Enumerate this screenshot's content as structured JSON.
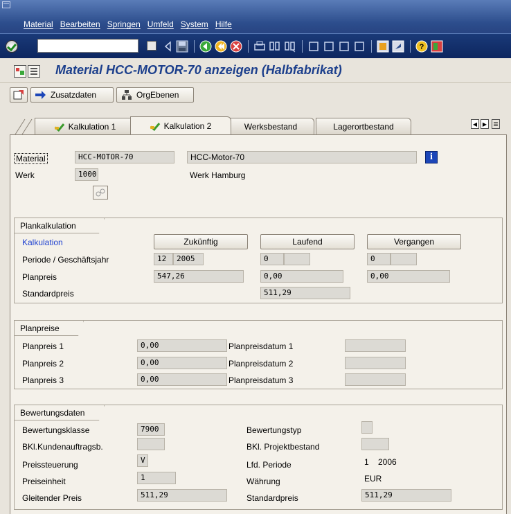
{
  "menubar": {
    "items": [
      "Material",
      "Bearbeiten",
      "Springen",
      "Umfeld",
      "System",
      "Hilfe"
    ]
  },
  "toolbar": {
    "command_value": "",
    "icons": [
      "enter-icon",
      "save-icon",
      "back-icon",
      "exit-icon",
      "cancel-icon",
      "print-icon",
      "find-icon",
      "find-next-icon",
      "first-page-icon",
      "prev-page-icon",
      "next-page-icon",
      "last-page-icon",
      "new-session-icon",
      "shortcut-icon",
      "help-icon",
      "layout-icon"
    ]
  },
  "title": {
    "text": "Material HCC-MOTOR-70 anzeigen (Halbfabrikat)"
  },
  "app_toolbar": {
    "zusatzdaten": "Zusatzdaten",
    "orgebenen": "OrgEbenen"
  },
  "tabs": [
    {
      "label": "Kalkulation 1",
      "checked": true,
      "active": false
    },
    {
      "label": "Kalkulation 2",
      "checked": true,
      "active": true
    },
    {
      "label": "Werksbestand",
      "checked": false,
      "active": false
    },
    {
      "label": "Lagerortbestand",
      "checked": false,
      "active": false
    }
  ],
  "header": {
    "material_label": "Material",
    "material_value": "HCC-MOTOR-70",
    "material_desc": "HCC-Motor-70",
    "werk_label": "Werk",
    "werk_value": "1000",
    "werk_desc": "Werk Hamburg"
  },
  "plankalkulation": {
    "title": "Plankalkulation",
    "kalkulation_label": "Kalkulation",
    "btn_zukuenftig": "Zukünftig",
    "btn_laufend": "Laufend",
    "btn_vergangen": "Vergangen",
    "periode_label": "Periode / Geschäftsjahr",
    "planpreis_label": "Planpreis",
    "standardpreis_label": "Standardpreis",
    "zuk_periode": "12",
    "zuk_jahr": "2005",
    "lauf_periode": "0",
    "lauf_jahr": "",
    "verg_periode": "0",
    "verg_jahr": "",
    "zuk_planpreis": "547,26",
    "lauf_planpreis": "0,00",
    "verg_planpreis": "0,00",
    "standardpreis": "511,29"
  },
  "planpreise": {
    "title": "Planpreise",
    "pp1_label": "Planpreis 1",
    "pp2_label": "Planpreis 2",
    "pp3_label": "Planpreis 3",
    "pp1_value": "0,00",
    "pp2_value": "0,00",
    "pp3_value": "0,00",
    "ppd1_label": "Planpreisdatum 1",
    "ppd2_label": "Planpreisdatum 2",
    "ppd3_label": "Planpreisdatum 3",
    "ppd1_value": "",
    "ppd2_value": "",
    "ppd3_value": ""
  },
  "bewertung": {
    "title": "Bewertungsdaten",
    "klasse_label": "Bewertungsklasse",
    "klasse_value": "7900",
    "typ_label": "Bewertungstyp",
    "typ_value": "",
    "bkl_ka_label": "BKl.Kundenauftragsb.",
    "bkl_ka_value": "",
    "bkl_pb_label": "BKl. Projektbestand",
    "bkl_pb_value": "",
    "preissteuerung_label": "Preissteuerung",
    "preissteuerung_value": "V",
    "lfd_periode_label": "Lfd. Periode",
    "lfd_periode_value": "1",
    "lfd_jahr_value": "2006",
    "preiseinheit_label": "Preiseinheit",
    "preiseinheit_value": "1",
    "waehrung_label": "Währung",
    "waehrung_value": "EUR",
    "gleitender_label": "Gleitender Preis",
    "gleitender_value": "511,29",
    "standardpreis_label": "Standardpreis",
    "standardpreis_value": "511,29"
  },
  "colors": {
    "menubar": "#2c4d8c",
    "title": "#1c3f8c",
    "panel": "#f4f1ea",
    "field": "#dcdad4",
    "link": "#1c3fd0"
  }
}
